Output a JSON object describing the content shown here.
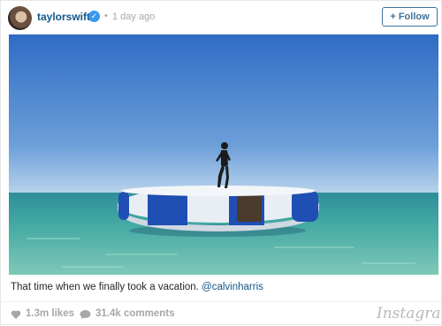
{
  "post": {
    "username": "taylorswift",
    "verified_icon": "check-icon",
    "separator": "•",
    "time": "1 day ago",
    "follow_label": "+ Follow",
    "caption_text": "That time when we finally took a vacation. ",
    "caption_mention": "@calvinharris",
    "likes": "1.3m likes",
    "comments": "31.4k comments",
    "brand": "Instagram"
  },
  "colors": {
    "link": "#125688",
    "follow": "#3f729b",
    "muted": "#a5a7aa",
    "sky": "#3f78c8",
    "sea": "#3fa6a0"
  }
}
